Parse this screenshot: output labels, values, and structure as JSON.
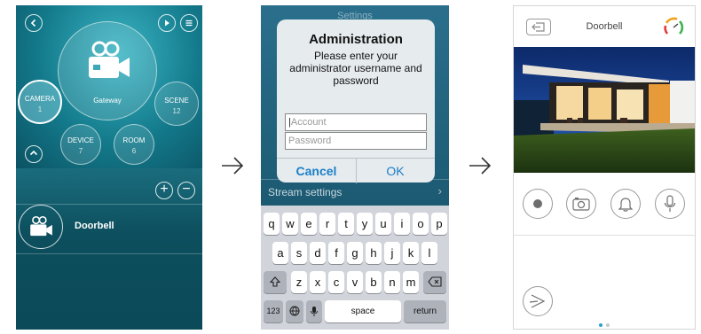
{
  "panel1": {
    "center_label": "Gateway",
    "camera": {
      "label": "CAMERA",
      "count": "1"
    },
    "scene": {
      "label": "SCENE",
      "count": "12"
    },
    "device": {
      "label": "DEVICE",
      "count": "7"
    },
    "room": {
      "label": "ROOM",
      "count": "6"
    },
    "device_name": "Doorbell"
  },
  "panel2": {
    "bg_title": "Settings",
    "bg_row_label": "Stream settings",
    "dialog": {
      "title": "Administration",
      "message": "Please enter your administrator username and password",
      "account_placeholder": "Account",
      "password_placeholder": "Password",
      "cancel_label": "Cancel",
      "ok_label": "OK"
    },
    "keyboard": {
      "row1": [
        "q",
        "w",
        "e",
        "r",
        "t",
        "y",
        "u",
        "i",
        "o",
        "p"
      ],
      "row2": [
        "a",
        "s",
        "d",
        "f",
        "g",
        "h",
        "j",
        "k",
        "l"
      ],
      "row3": [
        "z",
        "x",
        "c",
        "v",
        "b",
        "n",
        "m"
      ],
      "numbers_label": "123",
      "space_label": "space",
      "return_label": "return"
    }
  },
  "panel3": {
    "title": "Doorbell",
    "signal_colors": [
      "#e23b3b",
      "#f0a21a",
      "#3fb34f"
    ],
    "pager": {
      "count": 2,
      "active": 0
    }
  },
  "colors": {
    "teal": "#0f6e7e",
    "ios_blue": "#1a7fc8",
    "pager_active": "#2a9fd6"
  }
}
